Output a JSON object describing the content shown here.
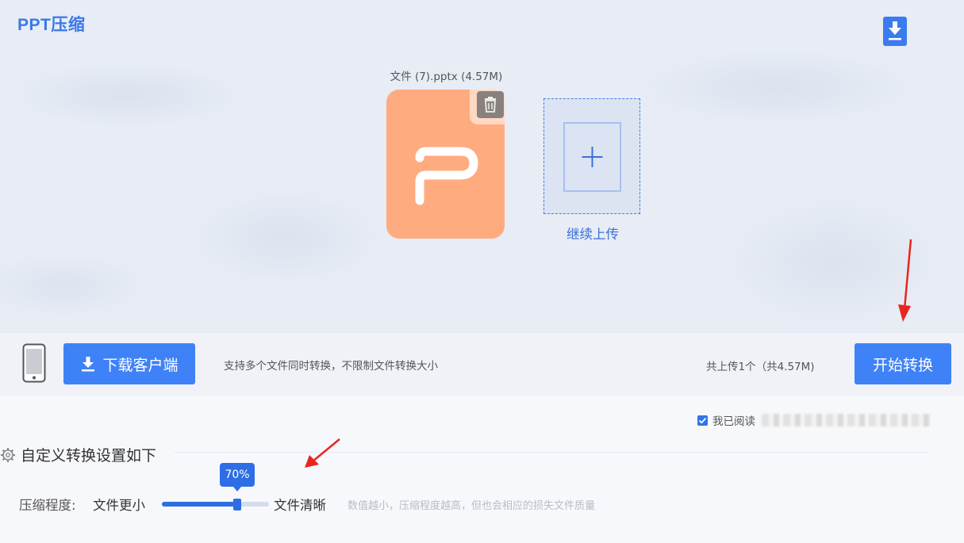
{
  "app": {
    "title": "PPT压缩"
  },
  "upload": {
    "file_name": "文件 (7).pptx (4.57M)",
    "add_more_label": "继续上传"
  },
  "toolbar": {
    "download_client_label": "下载客户端",
    "hint": "支持多个文件同时转换，不限制文件转换大小",
    "upload_count": "共上传1个（共4.57M)",
    "start_label": "开始转换"
  },
  "agreement": {
    "label": "我已阅读",
    "checked": true
  },
  "settings": {
    "title": "自定义转换设置如下",
    "compression_label": "压缩程度:",
    "smaller_label": "文件更小",
    "clearer_label": "文件清晰",
    "value_text": "70%",
    "value": 0.7,
    "hint": "数值越小，压缩程度越高，但也会相应的损失文件质量"
  },
  "colors": {
    "accent": "#3f82f7",
    "file_icon": "#ffab80",
    "annotation_arrow": "#e8261e"
  },
  "icons": [
    "download-icon",
    "ppt-file-icon",
    "trash-icon",
    "plus-icon",
    "phone-icon",
    "gear-icon",
    "checkbox-icon"
  ]
}
